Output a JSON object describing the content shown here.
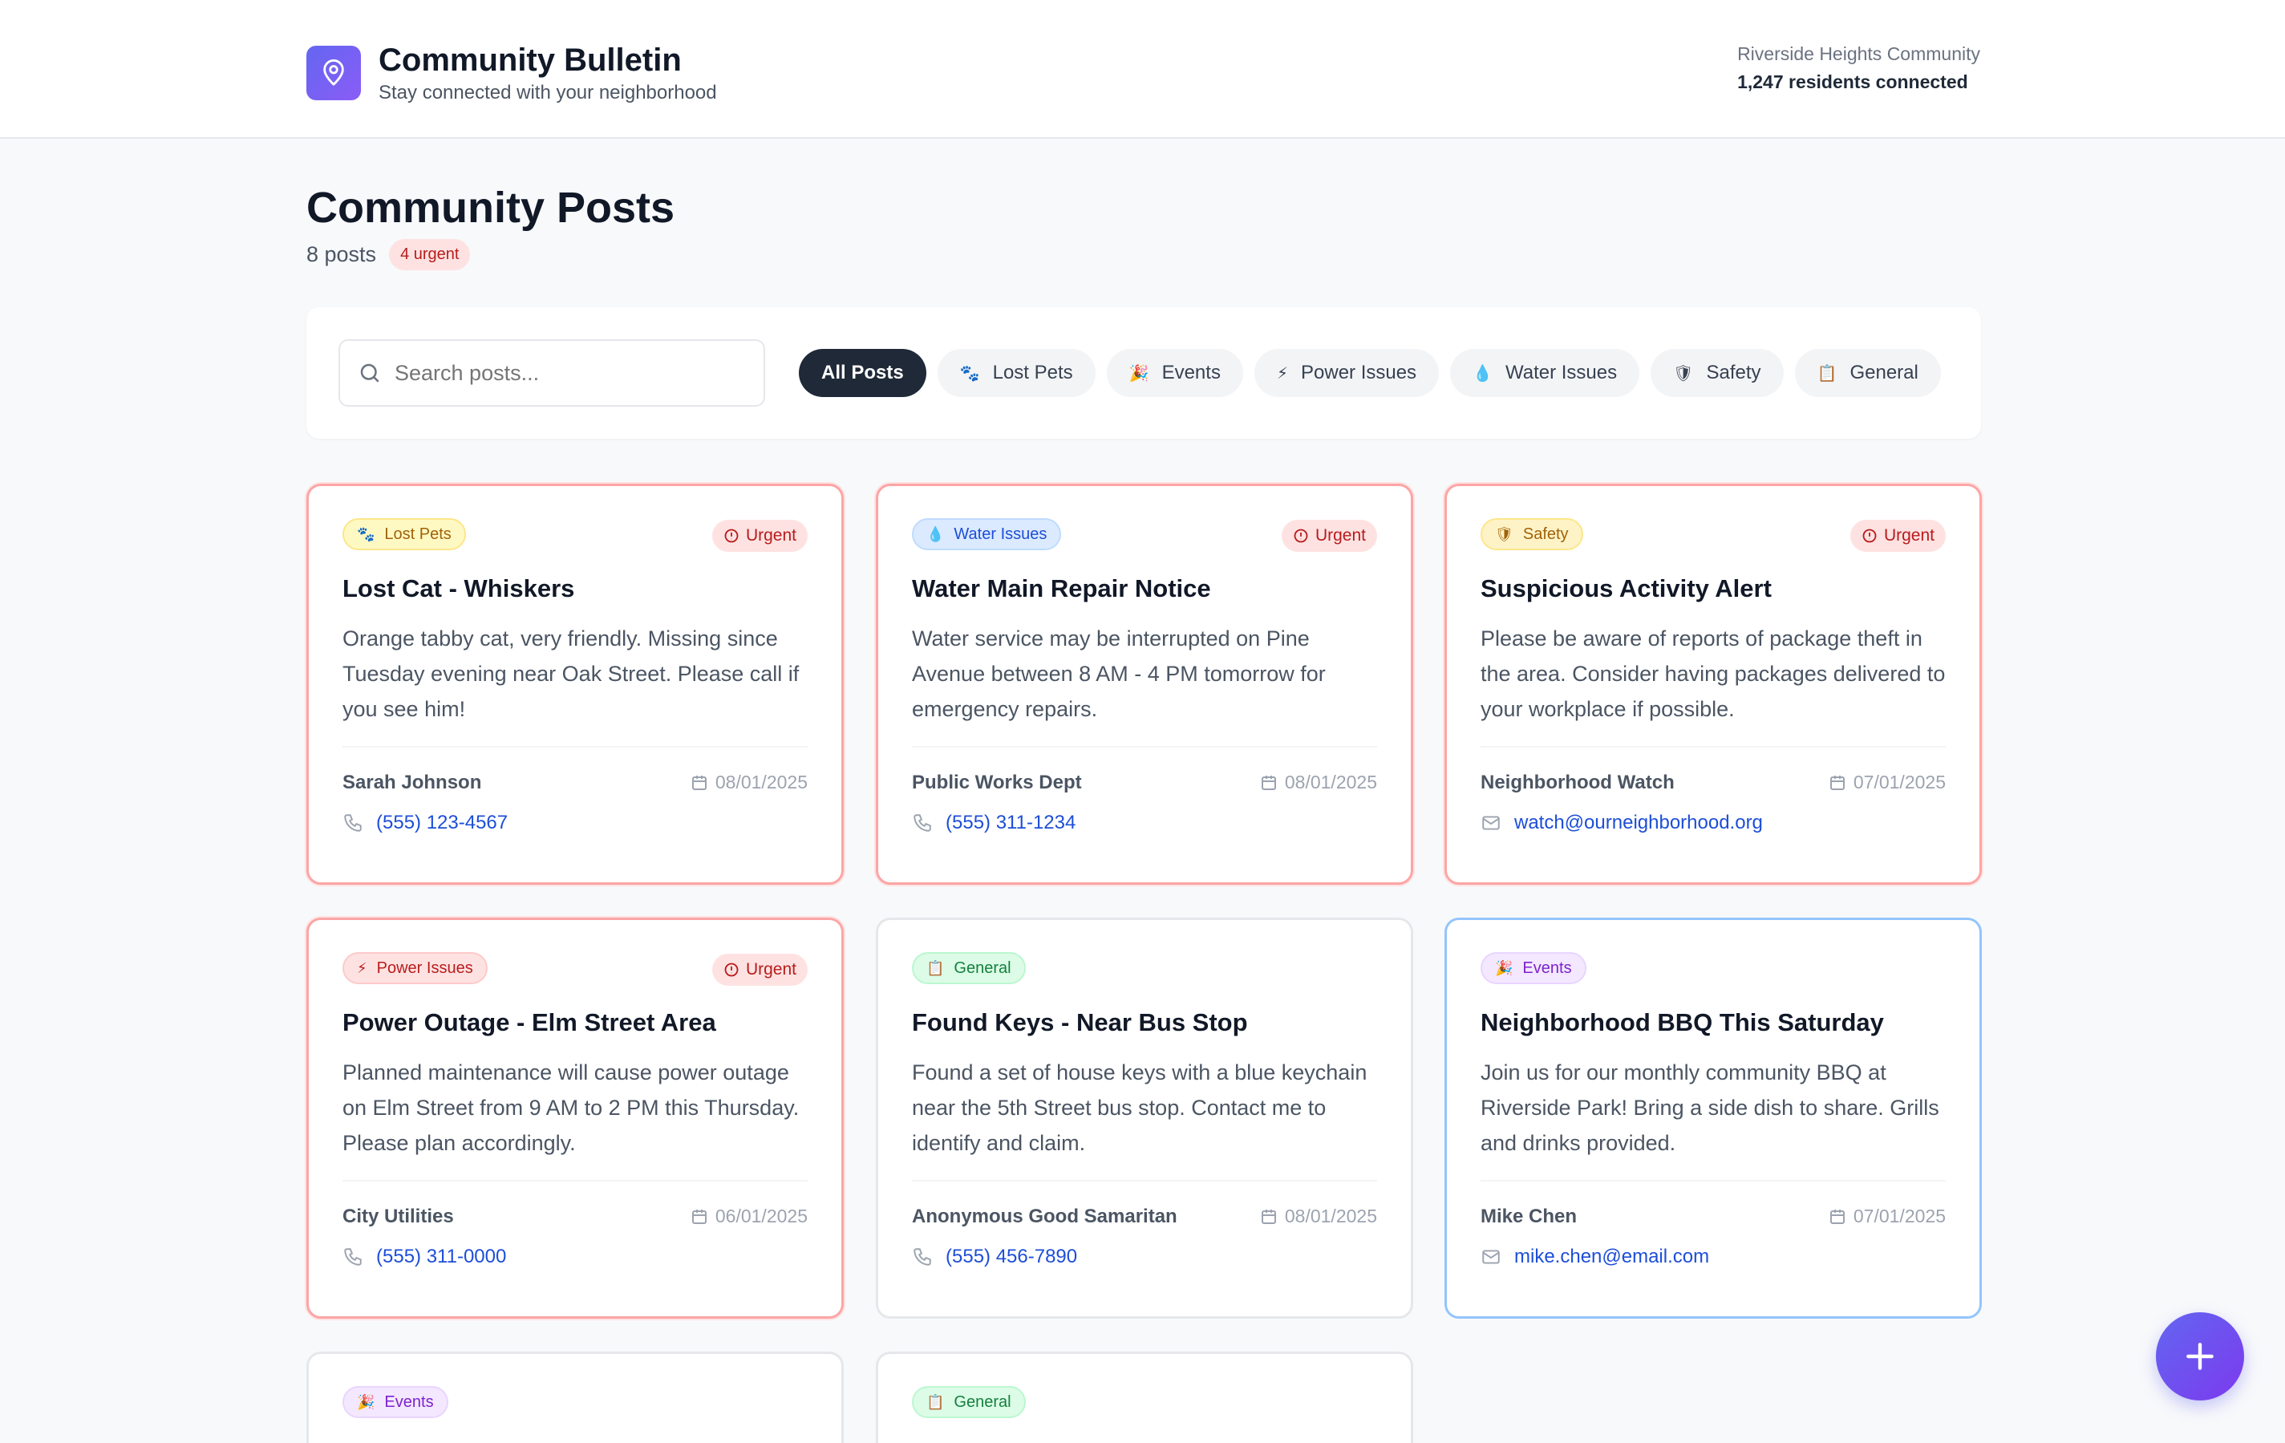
{
  "header": {
    "title": "Community Bulletin",
    "subtitle": "Stay connected with your neighborhood",
    "community_name": "Riverside Heights Community",
    "residents": "1,247 residents connected"
  },
  "page": {
    "title": "Community Posts",
    "post_count": "8 posts",
    "urgent_count": "4 urgent"
  },
  "search": {
    "placeholder": "Search posts..."
  },
  "filters": [
    {
      "label": "All Posts",
      "emoji": ""
    },
    {
      "label": "Lost Pets",
      "emoji": "🐾"
    },
    {
      "label": "Events",
      "emoji": "🎉"
    },
    {
      "label": "Power Issues",
      "emoji": "⚡"
    },
    {
      "label": "Water Issues",
      "emoji": "💧"
    },
    {
      "label": "Safety",
      "emoji": "🛡"
    },
    {
      "label": "General",
      "emoji": "📋"
    }
  ],
  "urgent_label": "Urgent",
  "posts": [
    {
      "category": "Lost Pets",
      "emoji": "🐾",
      "urgent": true,
      "title": "Lost Cat - Whiskers",
      "description": "Orange tabby cat, very friendly. Missing since Tuesday evening near Oak Street. Please call if you see him!",
      "author": "Sarah Johnson",
      "date": "08/01/2025",
      "contact_type": "phone",
      "contact": "(555) 123-4567"
    },
    {
      "category": "Water Issues",
      "emoji": "💧",
      "urgent": true,
      "title": "Water Main Repair Notice",
      "description": "Water service may be interrupted on Pine Avenue between 8 AM - 4 PM tomorrow for emergency repairs.",
      "author": "Public Works Dept",
      "date": "08/01/2025",
      "contact_type": "phone",
      "contact": "(555) 311-1234"
    },
    {
      "category": "Safety",
      "emoji": "🛡",
      "urgent": true,
      "title": "Suspicious Activity Alert",
      "description": "Please be aware of reports of package theft in the area. Consider having packages delivered to your workplace if possible.",
      "author": "Neighborhood Watch",
      "date": "07/01/2025",
      "contact_type": "email",
      "contact": "watch@ourneighborhood.org"
    },
    {
      "category": "Power Issues",
      "emoji": "⚡",
      "urgent": true,
      "title": "Power Outage - Elm Street Area",
      "description": "Planned maintenance will cause power outage on Elm Street from 9 AM to 2 PM this Thursday. Please plan accordingly.",
      "author": "City Utilities",
      "date": "06/01/2025",
      "contact_type": "phone",
      "contact": "(555) 311-0000"
    },
    {
      "category": "General",
      "emoji": "📋",
      "urgent": false,
      "title": "Found Keys - Near Bus Stop",
      "description": "Found a set of house keys with a blue keychain near the 5th Street bus stop. Contact me to identify and claim.",
      "author": "Anonymous Good Samaritan",
      "date": "08/01/2025",
      "contact_type": "phone",
      "contact": "(555) 456-7890"
    },
    {
      "category": "Events",
      "emoji": "🎉",
      "urgent": false,
      "title": "Neighborhood BBQ This Saturday",
      "description": "Join us for our monthly community BBQ at Riverside Park! Bring a side dish to share. Grills and drinks provided.",
      "author": "Mike Chen",
      "date": "07/01/2025",
      "contact_type": "email",
      "contact": "mike.chen@email.com"
    },
    {
      "category": "Events",
      "emoji": "🎉",
      "urgent": false
    },
    {
      "category": "General",
      "emoji": "📋",
      "urgent": false
    }
  ],
  "colors": {
    "accent": "#6366f1",
    "urgent_border": "#fca5a5",
    "link": "#1d4ed8"
  }
}
